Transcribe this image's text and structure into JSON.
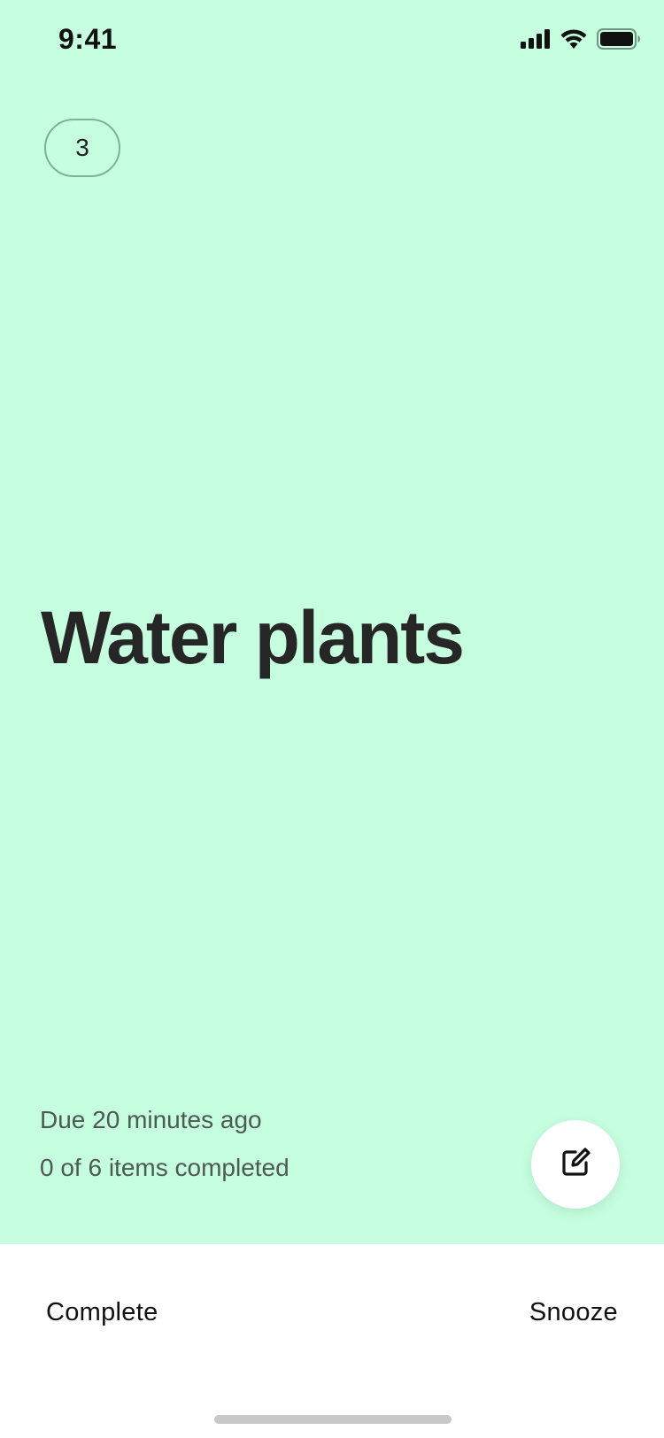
{
  "status_bar": {
    "time": "9:41",
    "icons": [
      "cellular-signal-icon",
      "wifi-icon",
      "battery-icon"
    ]
  },
  "task": {
    "count_badge": "3",
    "title": "Water plants",
    "due": "Due 20 minutes ago",
    "progress_text": "0 of 6 items completed",
    "items_completed": 0,
    "items_total": 6
  },
  "fab": {
    "icon": "edit-icon"
  },
  "actions": {
    "complete_label": "Complete",
    "snooze_label": "Snooze"
  },
  "colors": {
    "card_background": "#c5ffdf",
    "bottom_background": "#ffffff",
    "text_primary": "#262626",
    "text_secondary": "#4d5a52",
    "pill_border": "#7ab492"
  }
}
